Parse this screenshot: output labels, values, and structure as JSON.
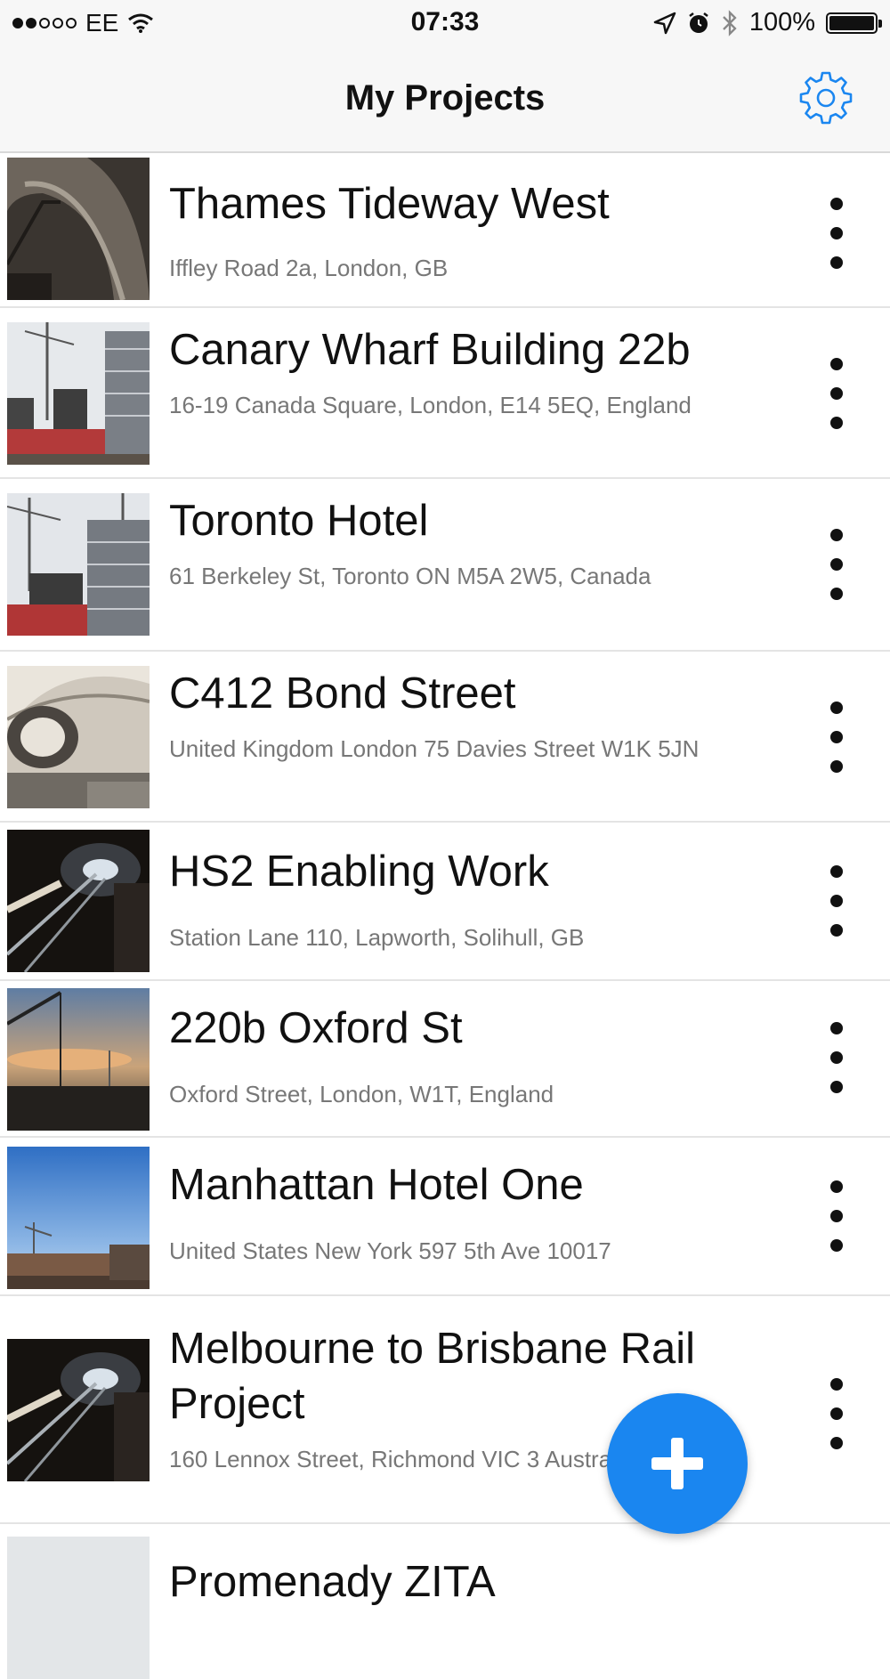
{
  "status_bar": {
    "carrier": "EE",
    "time": "07:33",
    "battery": "100%",
    "icons": [
      "signal-icon",
      "wifi-icon",
      "location-icon",
      "alarm-icon",
      "bluetooth-icon",
      "battery-icon"
    ]
  },
  "header": {
    "title": "My Projects",
    "settings_icon": "gear-icon"
  },
  "projects": [
    {
      "name": "Thames Tideway West",
      "address": "Iffley Road 2a, London, GB"
    },
    {
      "name": "Canary Wharf Building 22b",
      "address": "16-19 Canada Square, London, E14 5EQ, England"
    },
    {
      "name": "Toronto Hotel",
      "address": "61 Berkeley St, Toronto ON M5A 2W5, Canada"
    },
    {
      "name": "C412 Bond Street",
      "address": "United Kingdom London 75 Davies Street W1K 5JN"
    },
    {
      "name": "HS2 Enabling Work",
      "address": "Station Lane 110, Lapworth, Solihull, GB"
    },
    {
      "name": "220b Oxford St",
      "address": "Oxford Street, London, W1T, England"
    },
    {
      "name": "Manhattan Hotel One",
      "address": "United States New York 597 5th Ave 10017"
    },
    {
      "name": "Melbourne to Brisbane Rail Project",
      "address": "160 Lennox Street, Richmond VIC 3 Australia"
    },
    {
      "name": "Promenady ZITA",
      "address": ""
    }
  ],
  "fab": {
    "icon": "plus-icon",
    "color": "#1a86f0"
  },
  "colors": {
    "accent": "#1a86f0",
    "address_text": "#777777"
  }
}
